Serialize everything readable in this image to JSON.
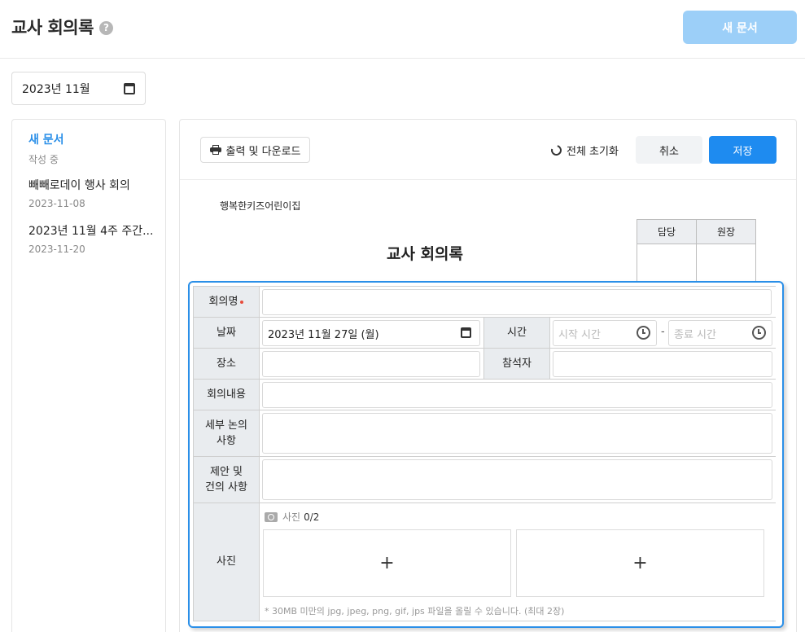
{
  "header": {
    "title": "교사 회의록",
    "new_document_label": "새 문서"
  },
  "month_filter": {
    "value": "2023년 11월"
  },
  "documents": [
    {
      "title": "새 문서",
      "subtitle": "작성 중"
    },
    {
      "title": "빼빼로데이 행사 회의",
      "subtitle": "2023-11-08"
    },
    {
      "title": "2023년 11월 4주 주간...",
      "subtitle": "2023-11-20"
    }
  ],
  "toolbar": {
    "print_label": "출력 및 다운로드",
    "reset_label": "전체 초기화",
    "cancel_label": "취소",
    "save_label": "저장"
  },
  "document": {
    "org_name": "행복한키즈어린이집",
    "heading": "교사 회의록",
    "approval": {
      "col1": "담당",
      "col2": "원장"
    }
  },
  "form": {
    "meeting_name_label": "회의명",
    "date_label": "날짜",
    "date_value": "2023년 11월 27일 (월)",
    "time_label": "시간",
    "start_time_placeholder": "시작 시간",
    "end_time_placeholder": "종료 시간",
    "time_separator": "-",
    "location_label": "장소",
    "attendees_label": "참석자",
    "content_label": "회의내용",
    "details_label_1": "세부 논의",
    "details_label_2": "사항",
    "proposal_label_1": "제안 및",
    "proposal_label_2": "건의 사항",
    "photo_label": "사진",
    "photo_header": "사진",
    "photo_count": "0/2",
    "photo_add": "+",
    "photo_note": "* 30MB 미만의 jpg, jpeg, png, gif, jps 파일을 올릴 수 있습니다. (최대 2장)"
  }
}
